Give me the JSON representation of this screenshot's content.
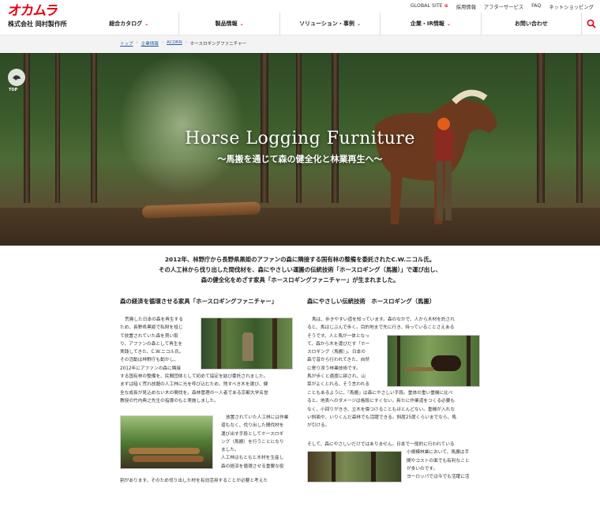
{
  "header": {
    "logo_mark": "オカムラ",
    "logo_company": "株式会社 岡村製作所",
    "util_links": [
      "GLOBAL SITE",
      "採用情報",
      "アフターサービス",
      "FAQ",
      "ネットショッピング"
    ],
    "nav": [
      "総合カタログ",
      "製品情報",
      "ソリューション・事例",
      "企業・IR情報",
      "お問い合わせ"
    ]
  },
  "breadcrumb": [
    "トップ",
    "企業情報",
    "ACORN",
    "ホースロギングファニチャー"
  ],
  "hero": {
    "top_label": "TOP",
    "title": "Horse Logging Furniture",
    "subtitle": "〜馬搬を通じて森の健全化と林業再生へ〜"
  },
  "intro": [
    "2012年、林野庁から長野県黒姫のアファンの森に隣接する国有林の整備を委託されたC.W.ニコル氏。",
    "その人工林から伐り出した間伐材を、森にやさしい運搬の伝統技術「ホースロギング（馬搬）」で運び出し、",
    "森の健全化をめざす家具「ホースロギングファニチャー」が生まれました。"
  ],
  "left": {
    "heading": "森の経済を循環させる家具「ホースロギングファニチャー」",
    "p1": [
      "荒廃した日本の森を再生する",
      "ため、長野県黒姫で私財を投じ",
      "て放置されていた森を買い取",
      "り、アファンの森として再生を",
      "実践してきた、C.W.ニコル氏。",
      "その活動は林野庁も動かし、",
      "2012年にアファンの森に隣接"
    ],
    "p2": [
      "する国有林の整備を、民間団体として初めて協定を結び委託されました。",
      "まずは暗く荒れ放題の人工林に光を呼び込むため、残すべき木を選び、健",
      "全な成長が見込めない木の間伐を。森林管理の一人者である京都大学名誉",
      "教授の竹内典之先生の指導のもと実施しました。"
    ],
    "p3": [
      "放置されていた人工林には作業",
      "道もなく、伐り出した間伐材を",
      "運び出す手段としてホースロギ",
      "ング（馬搬）を行うことになり",
      "ました。",
      "人工林はもともと木材を生産し",
      "森の経済を循環させる重要な役"
    ],
    "p4": [
      "割があります。そのため伐り出した材を有効活用することが必要と考えた"
    ]
  },
  "right": {
    "heading": "森にやさしい伝統技術　ホースロギング（馬搬）",
    "p1": [
      "馬は、歩きやすい道を知っています。森のなかで、人から木材を託され",
      "ると、馬はじぶんで歩く。目的地まで先に行き、待っていることさえある",
      "そうです。人と馬が一体となっ",
      "て、森から木を運びだす「ホー",
      "スロギング（馬搬）」。日本の",
      "森で昔から行われてきた、自然",
      "に寄り添う林業技術です。",
      "馬が歩くと適度に耕され、山",
      "菜がよくとれる、そう言われる"
    ],
    "p2": [
      "こともあるように、「馬搬」は森にやさしい手段。重体の重い重機に比べ",
      "ると、地表へのダメージは格段にすくない。新たに作業道をつくる必要も",
      "なく、小回りがきき、立木を傷つけることもほとんどない。重機が入れな",
      "い斜面や、いりくんだ森林でも活躍できる。斜度25度くらいまでなら、馬",
      "が引ける。"
    ],
    "p3": [
      "そして、森にやさしいだけではありません。日本で一般的に行われている",
      "小規模林業において、馬搬は手",
      "間やコストの面でも有利なこと",
      "が多いのです。",
      "ヨーロッパでは今でも活躍に活"
    ]
  }
}
